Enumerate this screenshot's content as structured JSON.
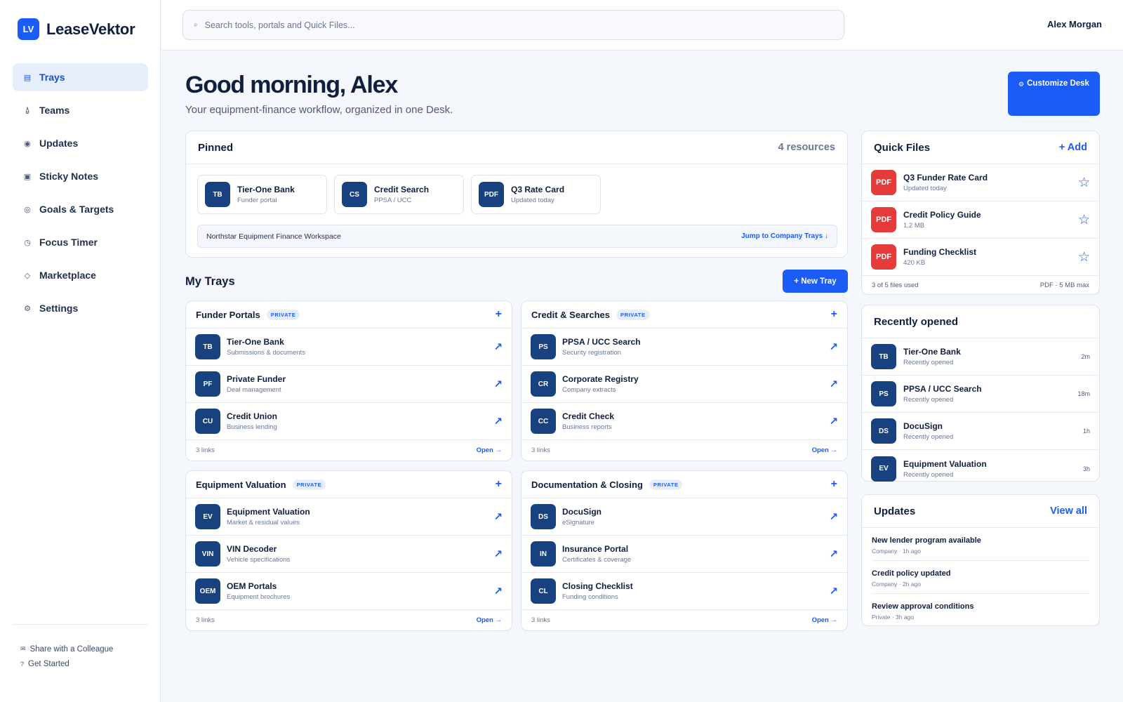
{
  "app": {
    "logo_mark": "LV",
    "name": "LeaseVektor"
  },
  "sidebar": {
    "items": [
      {
        "label": "Trays",
        "icon": "▤",
        "active": true
      },
      {
        "label": "Teams",
        "icon": "⍙"
      },
      {
        "label": "Updates",
        "icon": "◉"
      },
      {
        "label": "Sticky Notes",
        "icon": "▣"
      },
      {
        "label": "Goals & Targets",
        "icon": "◎"
      },
      {
        "label": "Focus Timer",
        "icon": "◷"
      },
      {
        "label": "Marketplace",
        "icon": "◇"
      },
      {
        "label": "Settings",
        "icon": "⚙"
      }
    ],
    "footer": [
      {
        "label": "Share with a Colleague",
        "icon": "✉"
      },
      {
        "label": "Get Started",
        "icon": "?"
      }
    ]
  },
  "topbar": {
    "search_placeholder": "Search tools, portals and Quick Files...",
    "user_name": "Alex Morgan"
  },
  "header": {
    "greeting": "Good morning, Alex",
    "subtitle": "Your equipment-finance workflow, organized in one Desk.",
    "customize_label": "Customize Desk"
  },
  "pinned": {
    "title": "Pinned",
    "count": "4 resources",
    "items": [
      {
        "initials": "TB",
        "title": "Tier-One Bank",
        "sub": "Funder portal"
      },
      {
        "initials": "CS",
        "title": "Credit Search",
        "sub": "PPSA / UCC"
      },
      {
        "initials": "PDF",
        "title": "Q3 Rate Card",
        "sub": "Updated today"
      }
    ],
    "workspace": "Northstar Equipment Finance Workspace",
    "workspace_link": "Jump to Company Trays ↓"
  },
  "my_trays": {
    "title": "My Trays",
    "new_label": "+ New Tray",
    "trays": [
      {
        "title": "Funder Portals",
        "badge": "PRIVATE",
        "count": "3 links",
        "open": "Open →",
        "links": [
          {
            "initials": "TB",
            "title": "Tier-One Bank",
            "sub": "Submissions & documents"
          },
          {
            "initials": "PF",
            "title": "Private Funder",
            "sub": "Deal management"
          },
          {
            "initials": "CU",
            "title": "Credit Union",
            "sub": "Business lending"
          }
        ]
      },
      {
        "title": "Credit & Searches",
        "badge": "PRIVATE",
        "count": "3 links",
        "open": "Open →",
        "links": [
          {
            "initials": "PS",
            "title": "PPSA / UCC Search",
            "sub": "Security registration"
          },
          {
            "initials": "CR",
            "title": "Corporate Registry",
            "sub": "Company extracts"
          },
          {
            "initials": "CC",
            "title": "Credit Check",
            "sub": "Business reports"
          }
        ]
      },
      {
        "title": "Equipment Valuation",
        "badge": "PRIVATE",
        "count": "3 links",
        "open": "Open →",
        "links": [
          {
            "initials": "EV",
            "title": "Equipment Valuation",
            "sub": "Market & residual values"
          },
          {
            "initials": "VIN",
            "title": "VIN Decoder",
            "sub": "Vehicle specifications"
          },
          {
            "initials": "OEM",
            "title": "OEM Portals",
            "sub": "Equipment brochures"
          }
        ]
      },
      {
        "title": "Documentation & Closing",
        "badge": "PRIVATE",
        "count": "3 links",
        "open": "Open →",
        "links": [
          {
            "initials": "DS",
            "title": "DocuSign",
            "sub": "eSignature"
          },
          {
            "initials": "IN",
            "title": "Insurance Portal",
            "sub": "Certificates & coverage"
          },
          {
            "initials": "CL",
            "title": "Closing Checklist",
            "sub": "Funding conditions"
          }
        ]
      }
    ]
  },
  "quick_files": {
    "title": "Quick Files",
    "add_label": "+ Add",
    "files": [
      {
        "type": "PDF",
        "title": "Q3 Funder Rate Card",
        "sub": "Updated today"
      },
      {
        "type": "PDF",
        "title": "Credit Policy Guide",
        "sub": "1.2 MB"
      },
      {
        "type": "PDF",
        "title": "Funding Checklist",
        "sub": "420 KB"
      }
    ],
    "usage": "3 of 5 files used",
    "limit": "PDF · 5 MB max"
  },
  "recent": {
    "title": "Recently opened",
    "items": [
      {
        "initials": "TB",
        "title": "Tier-One Bank",
        "sub": "Recently opened",
        "time": "2m"
      },
      {
        "initials": "PS",
        "title": "PPSA / UCC Search",
        "sub": "Recently opened",
        "time": "18m"
      },
      {
        "initials": "DS",
        "title": "DocuSign",
        "sub": "Recently opened",
        "time": "1h"
      },
      {
        "initials": "EV",
        "title": "Equipment Valuation",
        "sub": "Recently opened",
        "time": "3h"
      }
    ]
  },
  "updates": {
    "title": "Updates",
    "view_all": "View all",
    "items": [
      {
        "title": "New lender program available",
        "sub": "Company · 1h ago"
      },
      {
        "title": "Credit policy updated",
        "sub": "Company · 2h ago"
      },
      {
        "title": "Review approval conditions",
        "sub": "Private · 3h ago"
      }
    ]
  },
  "colors": {
    "accent": "#1a5cf5",
    "avatar": "#17427f",
    "pdf": "#e53b3b"
  }
}
